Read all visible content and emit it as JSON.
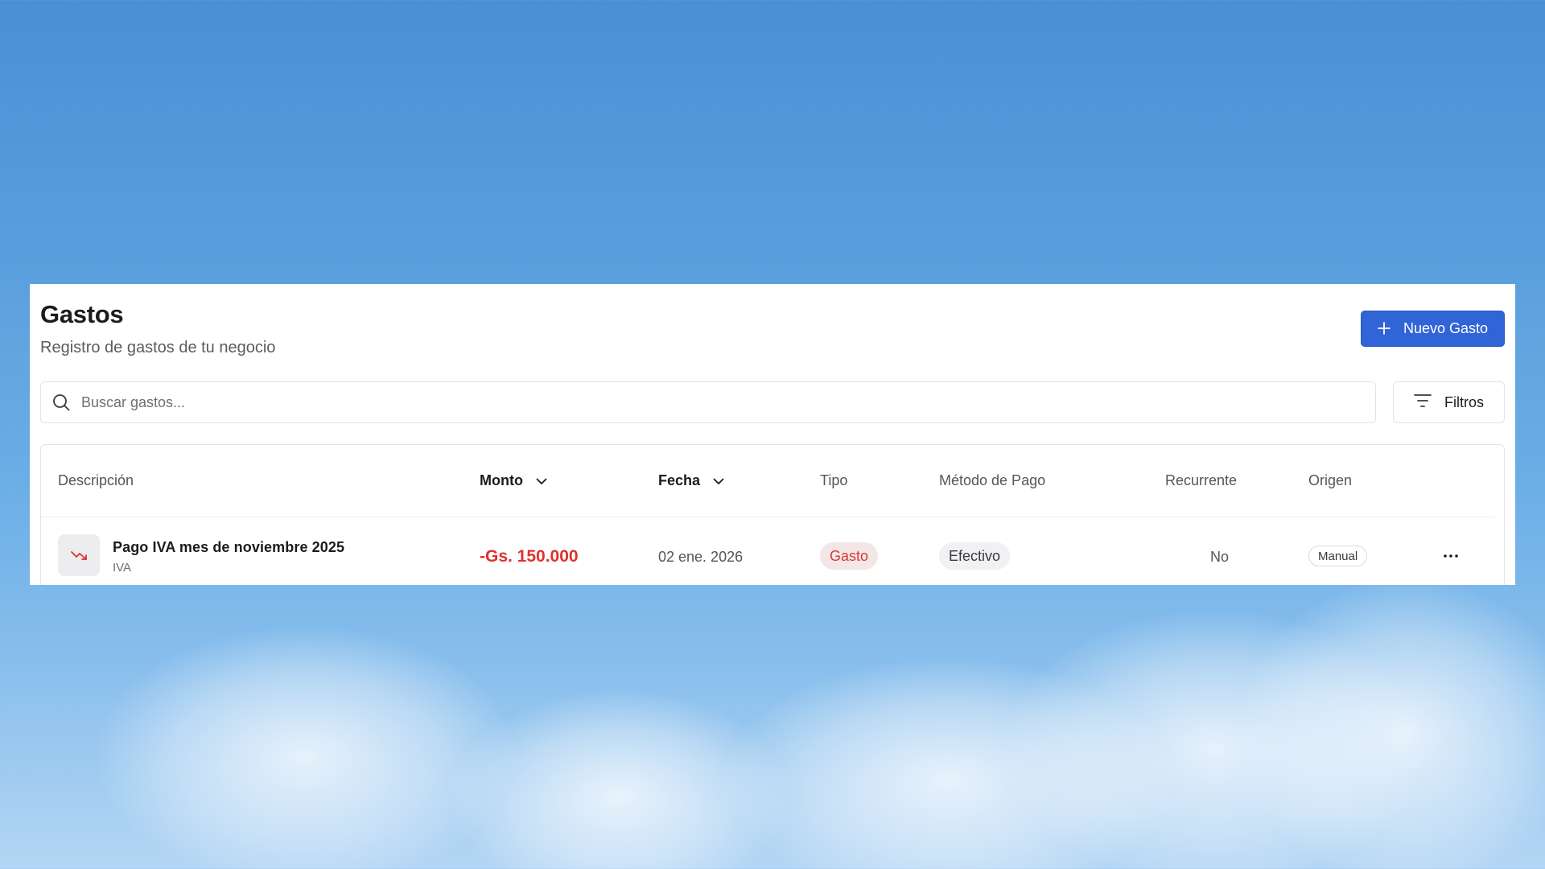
{
  "page": {
    "title": "Gastos",
    "subtitle": "Registro de gastos de tu negocio"
  },
  "toolbar": {
    "new_button_icon": "plus-icon",
    "new_button_label": "Nuevo Gasto",
    "search_icon": "search-icon",
    "search_placeholder": "Buscar gastos...",
    "search_value": "",
    "filter_icon": "filter-icon",
    "filter_label": "Filtros"
  },
  "table": {
    "columns": [
      {
        "label": "Descripción",
        "sortable": false
      },
      {
        "label": "Monto",
        "sortable": true,
        "icon": "chevron-down-icon"
      },
      {
        "label": "Fecha",
        "sortable": true,
        "icon": "chevron-down-icon"
      },
      {
        "label": "Tipo",
        "sortable": false
      },
      {
        "label": "Método de Pago",
        "sortable": false
      },
      {
        "label": "Recurrente",
        "sortable": false
      },
      {
        "label": "Origen",
        "sortable": false
      }
    ],
    "rows": [
      {
        "icon": "trending-down-icon",
        "title": "Pago IVA mes de noviembre 2025",
        "category": "IVA",
        "amount": "-Gs. 150.000",
        "date": "02 ene. 2026",
        "type": "Gasto",
        "payment_method": "Efectivo",
        "recurrent": "No",
        "origin": "Manual",
        "menu_icon": "more-horizontal-icon"
      }
    ]
  },
  "colors": {
    "accent": "#3164d6",
    "negative": "#e0312e",
    "sky_top": "#4a8fd4",
    "sky_bottom": "#b4d6f4"
  }
}
